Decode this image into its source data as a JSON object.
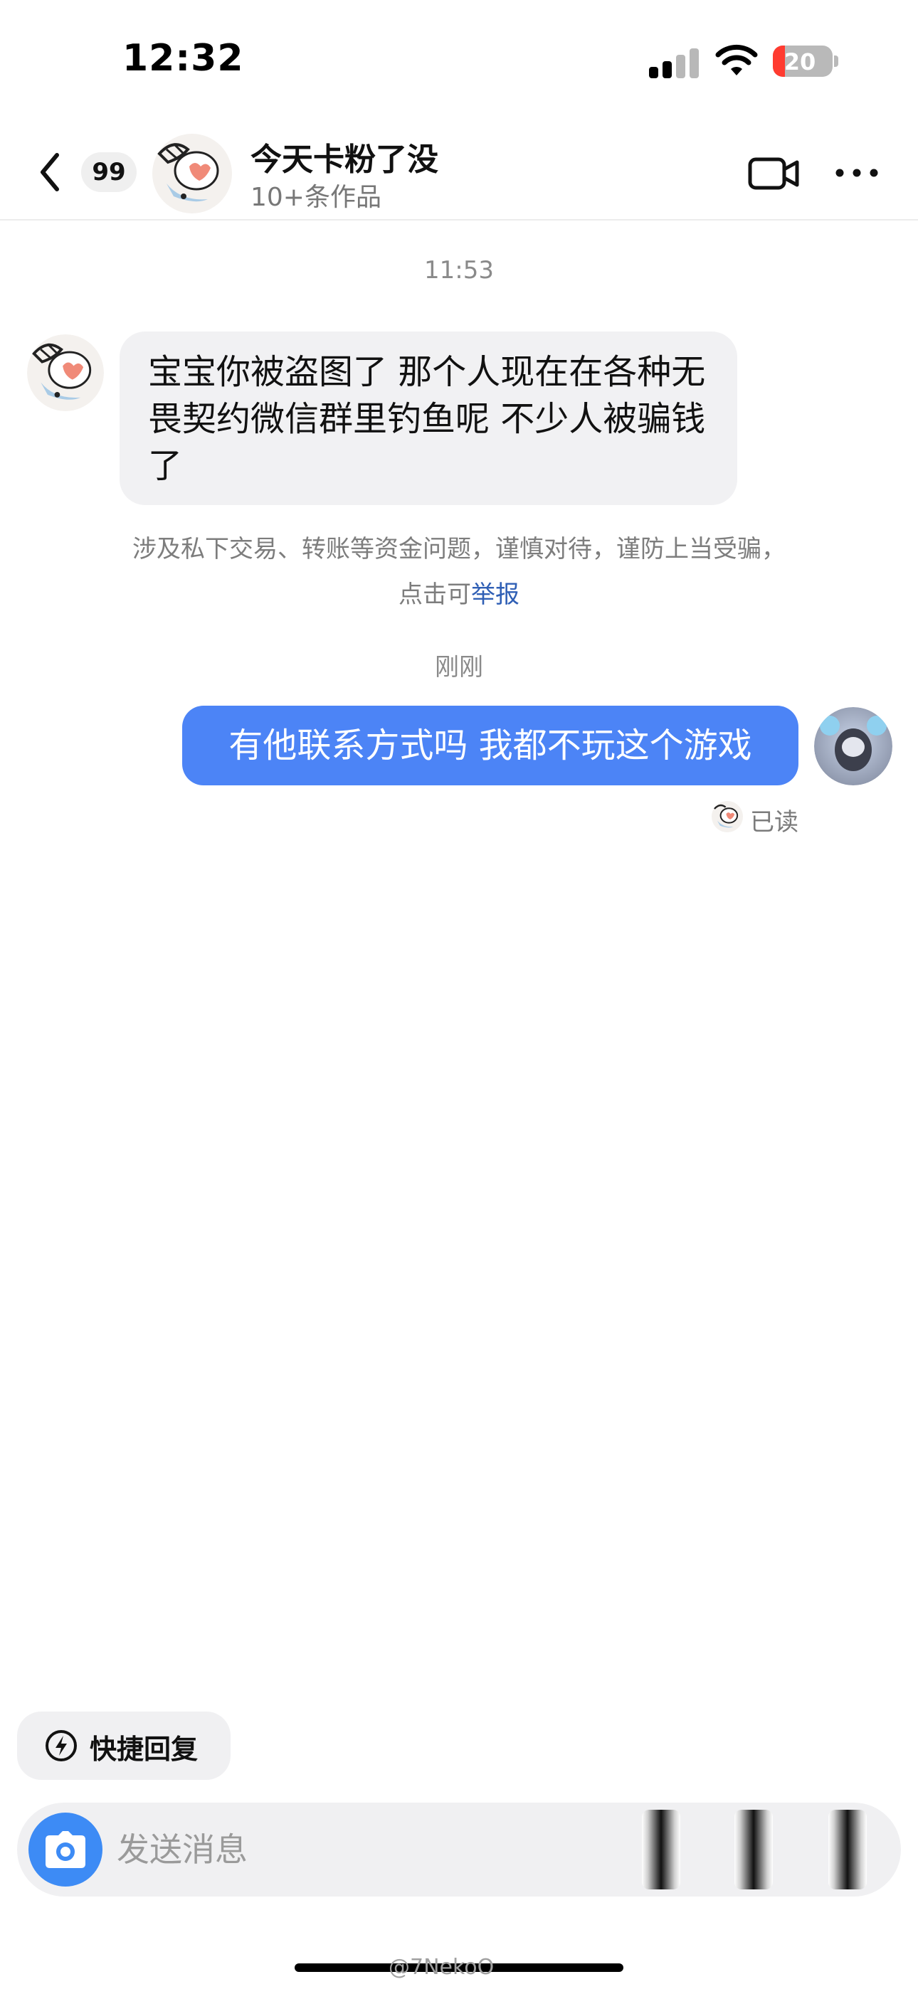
{
  "status_bar": {
    "time": "12:32",
    "battery_level": "20",
    "battery_fraction": 0.2,
    "icons": [
      "signal-icon",
      "wifi-icon",
      "battery-icon"
    ]
  },
  "header": {
    "unread_count": "99",
    "contact_name": "今天卡粉了没",
    "works_count": "10+条作品",
    "icons": [
      "back-icon",
      "video-call-icon",
      "more-icon"
    ]
  },
  "messages": [
    {
      "type": "timestamp",
      "text": "11:53"
    },
    {
      "type": "incoming",
      "text": "宝宝你被盗图了 那个人现在在各种无畏契约微信群里钓鱼呢 不少人被骗钱了"
    },
    {
      "type": "warning",
      "text": "涉及私下交易、转账等资金问题，谨慎对待，谨防上当受骗，",
      "line2_prefix": "点击可",
      "link_text": "举报"
    },
    {
      "type": "timestamp",
      "text": "刚刚"
    },
    {
      "type": "outgoing",
      "text": "有他联系方式吗 我都不玩这个游戏"
    },
    {
      "type": "read_receipt",
      "text": "已读"
    }
  ],
  "composer": {
    "quick_reply_label": "快捷回复",
    "input_placeholder": "发送消息",
    "icons": [
      "lightning-icon",
      "camera-icon"
    ]
  },
  "watermark": "@7NekoO",
  "colors": {
    "outgoing_bubble": "#4c84f6",
    "incoming_bubble": "#f1f1f3",
    "link": "#2f5fb5",
    "camera_button": "#3d8bf5",
    "battery_low": "#ff3b30"
  }
}
